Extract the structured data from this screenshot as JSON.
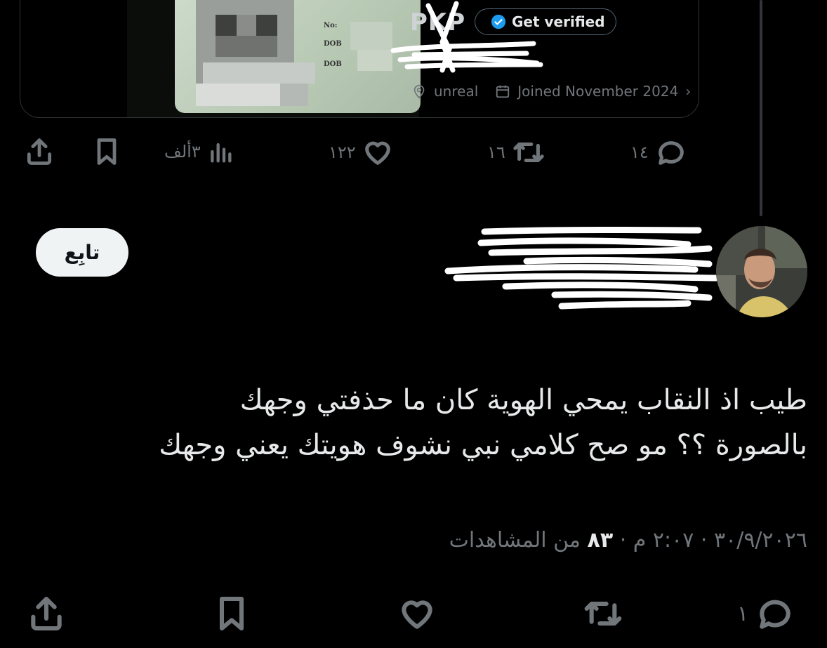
{
  "quoted": {
    "id_card_labels": [
      "No:",
      "DOB",
      "DOB"
    ],
    "profile_name": "PKP",
    "verify_label": "Get verified",
    "location": "unreal",
    "joined": "Joined November 2024",
    "actions": {
      "replies": "١٤",
      "reposts": "١٦",
      "likes": "١٢٢",
      "views": "٣ألف"
    }
  },
  "tweet": {
    "follow_label": "تابِع",
    "text_line1": "طيب اذ النقاب يمحي الهوية كان ما حذفتي وجهك",
    "text_line2": "بالصورة ؟؟ مو صح كلامي نبي نشوف هويتك يعني وجهك",
    "date": "٣٠/٩/٢٠٢٦",
    "time": "٢:٠٧ م",
    "views_count": "٨٣",
    "views_label": "من المشاهدات",
    "replies": "١"
  },
  "colors": {
    "background": "#000000",
    "text": "#e7e9ea",
    "muted": "#71767b",
    "verified_blue": "#1d9bf0",
    "follow_bg": "#eff3f4"
  }
}
